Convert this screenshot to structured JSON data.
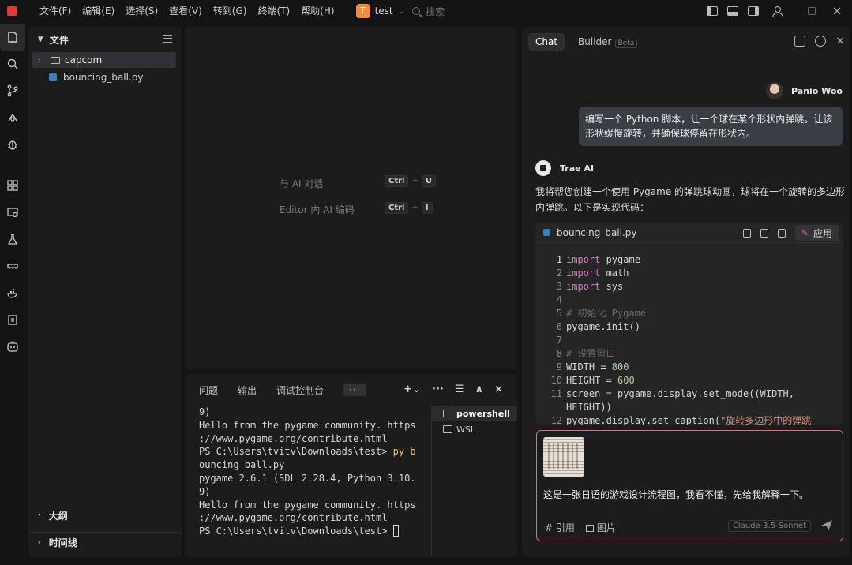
{
  "titlebar": {
    "menu": [
      "文件(F)",
      "编辑(E)",
      "选择(S)",
      "查看(V)",
      "转到(G)",
      "终端(T)",
      "帮助(H)"
    ],
    "project_badge": "T",
    "project_name": "test",
    "search_placeholder": "搜索"
  },
  "explorer": {
    "title": "文件",
    "items": [
      {
        "name": "capcom",
        "type": "folder"
      },
      {
        "name": "bouncing_ball.py",
        "type": "file"
      }
    ],
    "outline": "大纲",
    "timeline": "时间线"
  },
  "editor": {
    "hints": [
      {
        "label": "与 AI 对话",
        "keys": [
          "Ctrl",
          "+",
          "U"
        ]
      },
      {
        "label": "Editor 内 AI 编码",
        "keys": [
          "Ctrl",
          "+",
          "I"
        ]
      }
    ]
  },
  "panel": {
    "tabs": [
      "问题",
      "输出",
      "调试控制台"
    ],
    "more": "···",
    "terminal_lines": [
      "9)",
      "Hello from the pygame community. https",
      "://www.pygame.org/contribute.html",
      "PS C:\\Users\\tvitv\\Downloads\\test> ",
      "ouncing_ball.py",
      "pygame 2.6.1 (SDL 2.28.4, Python 3.10.",
      "9)",
      "Hello from the pygame community. https",
      "://www.pygame.org/contribute.html",
      "PS C:\\Users\\tvitv\\Downloads\\test> "
    ],
    "command_highlight": "py b",
    "shells": [
      "powershell",
      "WSL"
    ]
  },
  "chat": {
    "tabs": [
      "Chat",
      "Builder"
    ],
    "beta": "Beta",
    "user_name": "Panio Woo",
    "user_message": "编写一个 Python 脚本，让一个球在某个形状内弹跳。让该形状缓慢旋转，并确保球停留在形状内。",
    "ai_name": "Trae AI",
    "ai_intro": "我将帮您创建一个使用 Pygame 的弹跳球动画，球将在一个旋转的多边形内弹跳。以下是实现代码：",
    "code_filename": "bouncing_ball.py",
    "apply_label": "应用",
    "code_lines": [
      {
        "n": "1",
        "parts": [
          [
            "kw",
            "import"
          ],
          [
            "pl",
            " pygame"
          ]
        ]
      },
      {
        "n": "2",
        "parts": [
          [
            "kw",
            "import"
          ],
          [
            "pl",
            " math"
          ]
        ]
      },
      {
        "n": "3",
        "parts": [
          [
            "kw",
            "import"
          ],
          [
            "pl",
            " sys"
          ]
        ]
      },
      {
        "n": "4",
        "parts": []
      },
      {
        "n": "5",
        "parts": [
          [
            "cm",
            "# 初始化 Pygame"
          ]
        ]
      },
      {
        "n": "6",
        "parts": [
          [
            "pl",
            "pygame.init()"
          ]
        ]
      },
      {
        "n": "7",
        "parts": []
      },
      {
        "n": "8",
        "parts": [
          [
            "cm",
            "# 设置窗口"
          ]
        ]
      },
      {
        "n": "9",
        "parts": [
          [
            "pl",
            "WIDTH = "
          ],
          [
            "num",
            "800"
          ]
        ]
      },
      {
        "n": "10",
        "parts": [
          [
            "pl",
            "HEIGHT = "
          ],
          [
            "num",
            "600"
          ]
        ]
      },
      {
        "n": "11",
        "parts": [
          [
            "pl",
            "screen = pygame.display.set_mode((WIDTH,"
          ]
        ]
      },
      {
        "n": "",
        "parts": [
          [
            "pl",
            "HEIGHT))"
          ]
        ]
      },
      {
        "n": "12",
        "parts": [
          [
            "pl",
            "pygame.display.set_caption("
          ],
          [
            "str",
            "\"旋转多边形中的弹跳"
          ]
        ]
      }
    ],
    "input_text": "这是一张日语的游戏设计流程图，我看不懂，先给我解释一下。",
    "input_actions": [
      "# 引用",
      "图片"
    ],
    "model": "Claude-3.5-Sonnet"
  }
}
